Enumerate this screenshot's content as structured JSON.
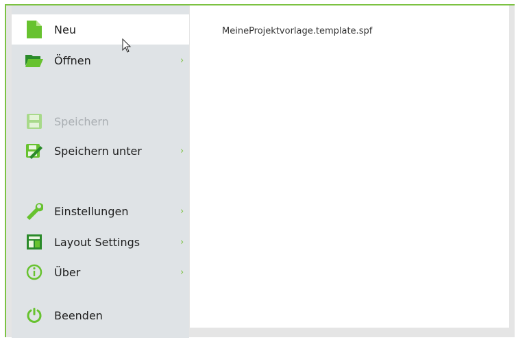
{
  "file_name": "MeineProjektvorlage.template.spf",
  "menu": {
    "items": [
      {
        "label": "Neu",
        "icon": "new-document-icon",
        "selected": true,
        "submenu": false
      },
      {
        "label": "Öffnen",
        "icon": "open-folder-icon",
        "selected": false,
        "submenu": true
      },
      {
        "label": "Speichern",
        "icon": "save-icon",
        "disabled": true,
        "submenu": false
      },
      {
        "label": "Speichern unter",
        "icon": "save-as-icon",
        "submenu": true
      },
      {
        "label": "Einstellungen",
        "icon": "wrench-icon",
        "submenu": true
      },
      {
        "label": "Layout Settings",
        "icon": "layout-icon",
        "submenu": true
      },
      {
        "label": "Über",
        "icon": "info-icon",
        "submenu": true
      },
      {
        "label": "Beenden",
        "icon": "power-icon",
        "submenu": false
      }
    ],
    "chevron": "›"
  },
  "colors": {
    "accent": "#7cc242",
    "menu_bg": "#dfe3e6",
    "disabled": "#a9aeb2"
  }
}
